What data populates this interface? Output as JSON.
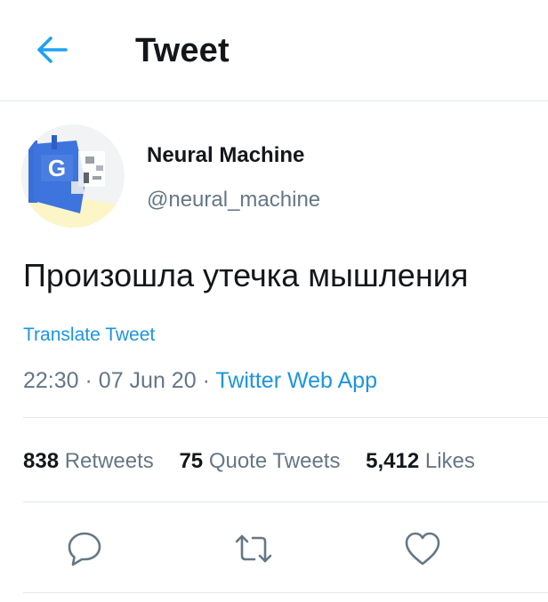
{
  "header": {
    "title": "Tweet"
  },
  "author": {
    "display_name": "Neural Machine",
    "handle": "@neural_machine",
    "avatar_letter": "G"
  },
  "tweet": {
    "text": "Произошла утечка мышления",
    "translate_label": "Translate Tweet",
    "time": "22:30",
    "separator": "·",
    "date": "07 Jun 20",
    "source": "Twitter Web App"
  },
  "stats": {
    "retweets_count": "838",
    "retweets_label": "Retweets",
    "quotes_count": "75",
    "quotes_label": "Quote Tweets",
    "likes_count": "5,412",
    "likes_label": "Likes"
  },
  "icons": {
    "back": "arrow-left-icon",
    "reply": "reply-icon",
    "retweet": "retweet-icon",
    "like": "heart-icon"
  },
  "colors": {
    "accent": "#1da1f2",
    "link": "#1b95e0",
    "secondary_text": "#657786",
    "divider": "#e1e8ed"
  }
}
